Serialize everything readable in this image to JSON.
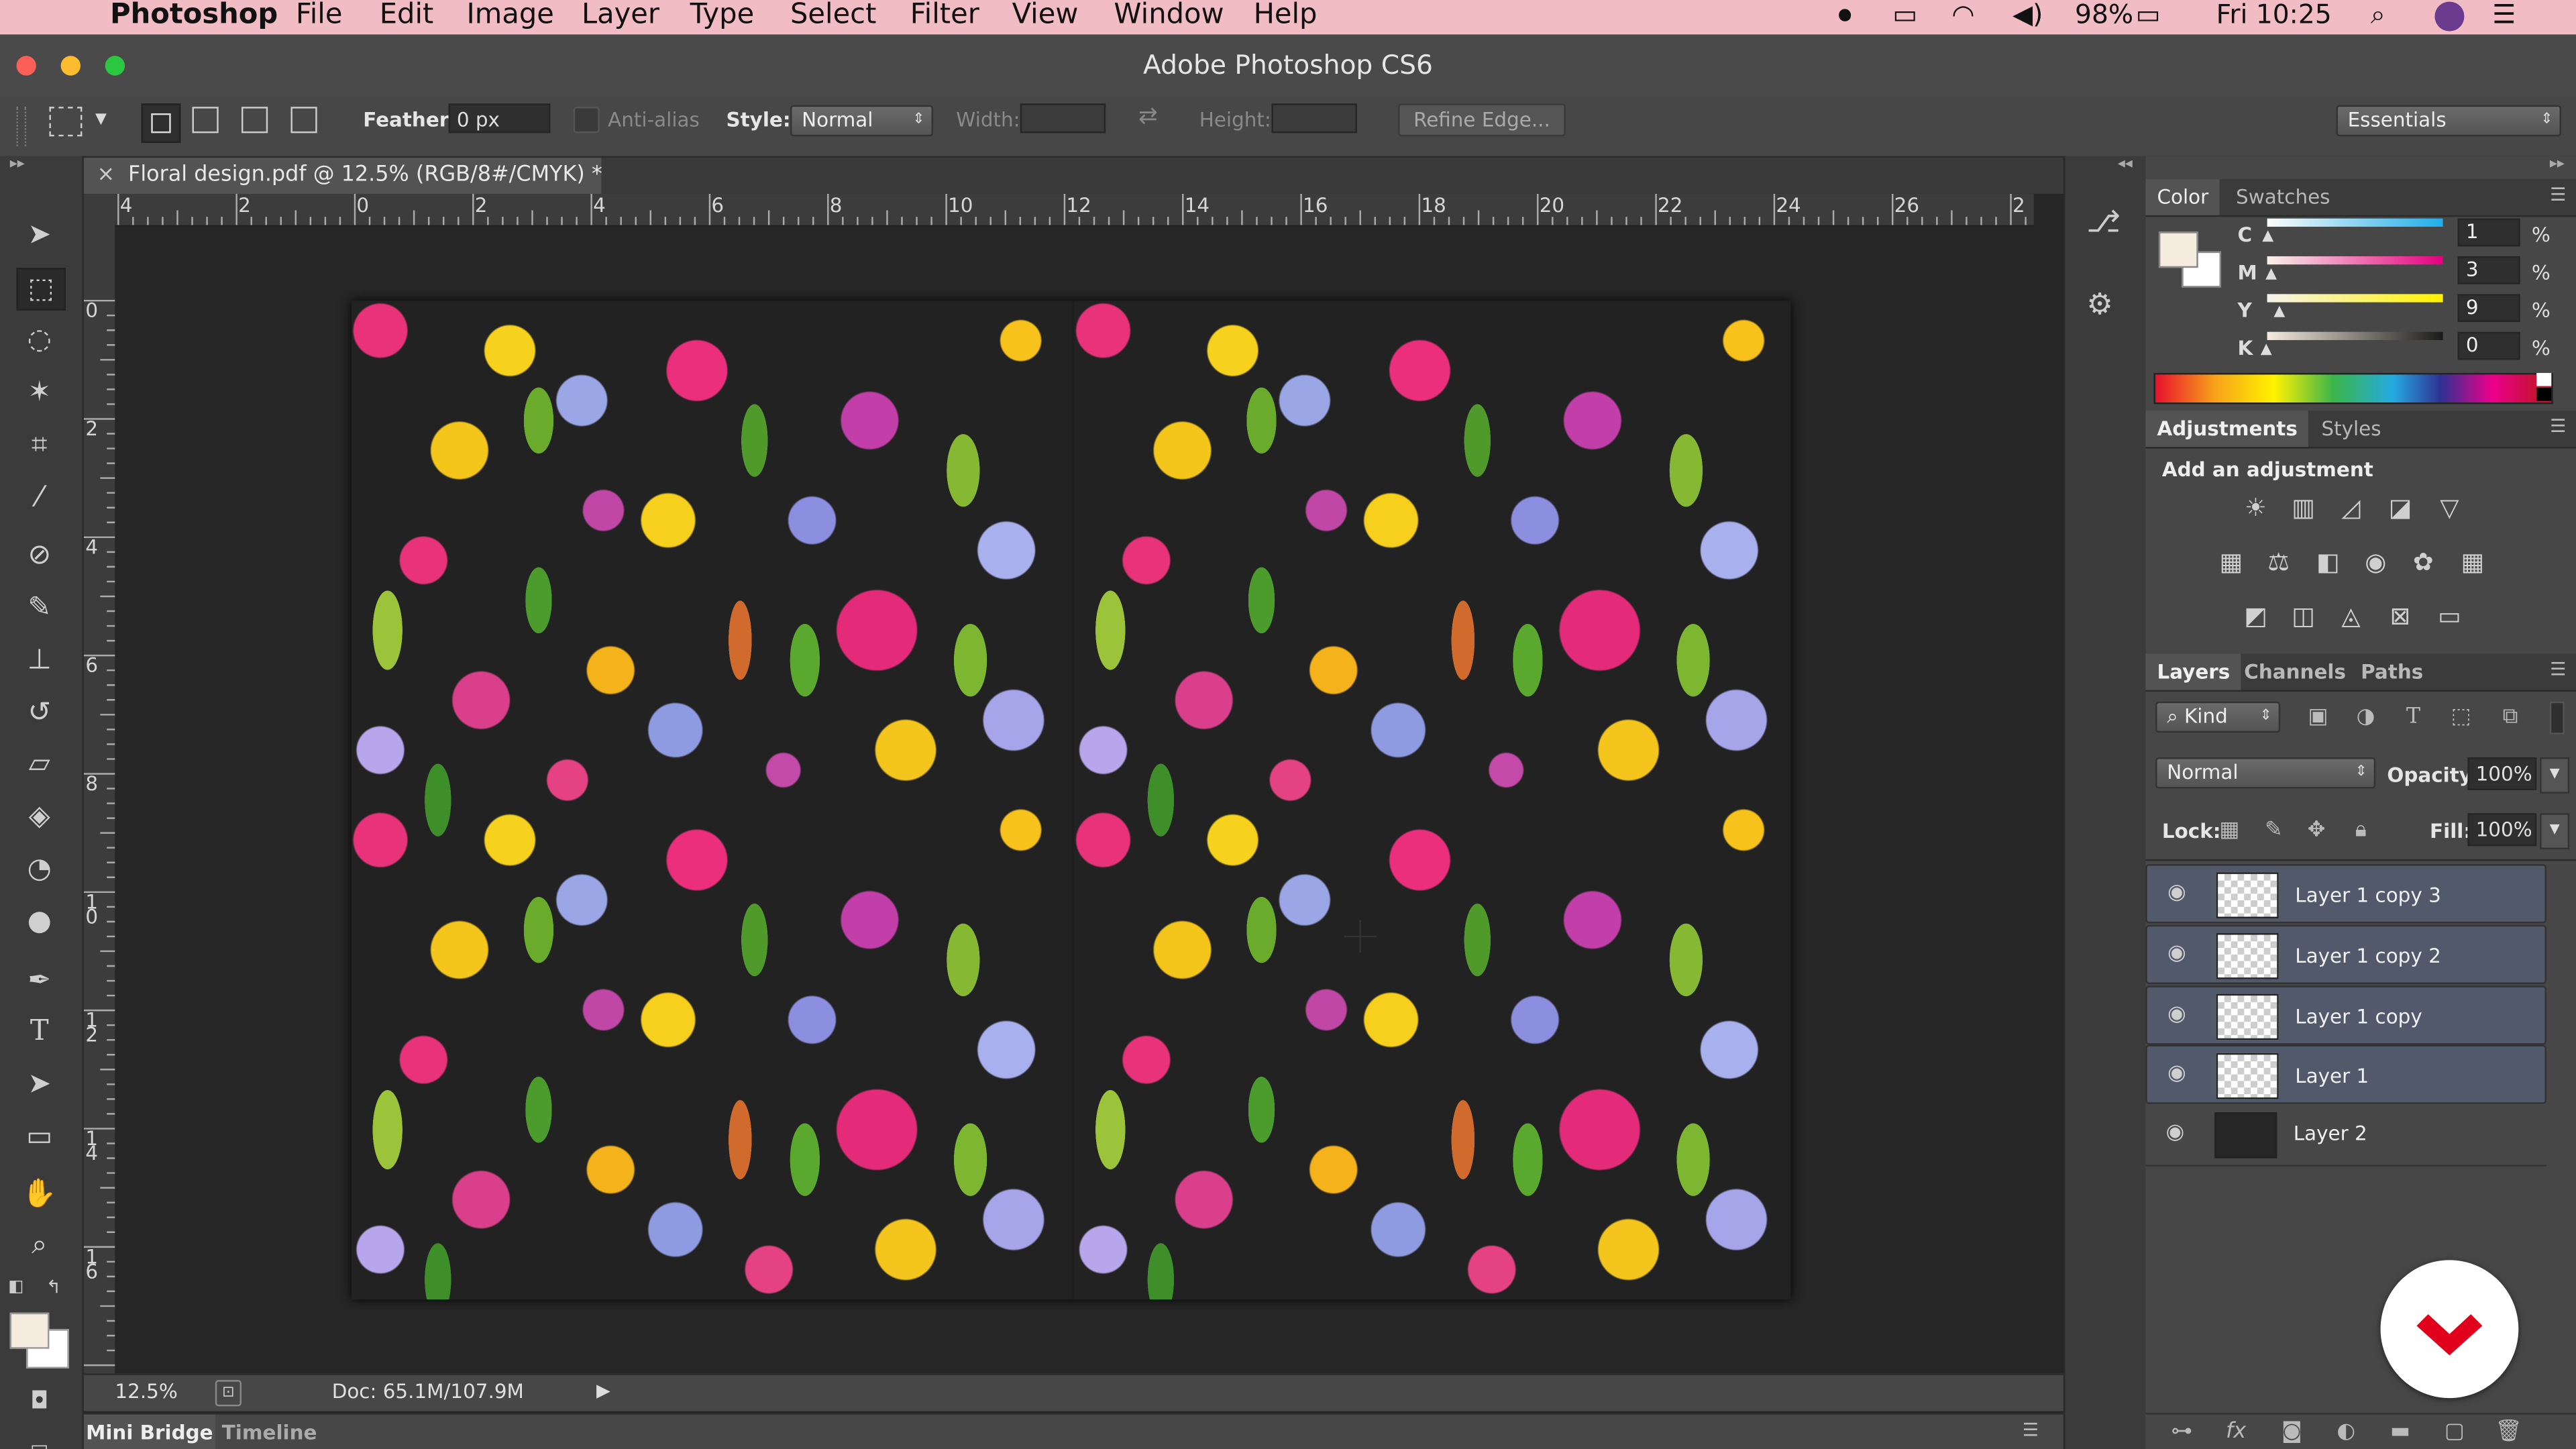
{
  "menubar": {
    "app": "Photoshop",
    "items": [
      "File",
      "Edit",
      "Image",
      "Layer",
      "Type",
      "Select",
      "Filter",
      "View",
      "Window",
      "Help"
    ],
    "battery": "98%",
    "clock": "Fri 10:25"
  },
  "window": {
    "title": "Adobe Photoshop CS6"
  },
  "options": {
    "feather_label": "Feather:",
    "feather_value": "0 px",
    "antialias_label": "Anti-alias",
    "style_label": "Style:",
    "style_value": "Normal",
    "width_label": "Width:",
    "height_label": "Height:",
    "refine_edge": "Refine Edge...",
    "workspace": "Essentials"
  },
  "document": {
    "tab_title": "Floral design.pdf @ 12.5% (RGB/8#/CMYK) *",
    "close_glyph": "×"
  },
  "rulers": {
    "horizontal": [
      "4",
      "2",
      "0",
      "2",
      "4",
      "6",
      "8",
      "10",
      "12",
      "14",
      "16",
      "18",
      "20",
      "22",
      "24",
      "26",
      "2"
    ],
    "vertical": [
      "0",
      "2",
      "4",
      "6",
      "8",
      "1\n0",
      "1\n2",
      "1\n4",
      "1\n6"
    ]
  },
  "statusbar": {
    "zoom": "12.5%",
    "doc": "Doc: 65.1M/107.9M"
  },
  "bottom_tabs": [
    "Mini Bridge",
    "Timeline"
  ],
  "color_panel": {
    "tabs": [
      "Color",
      "Swatches"
    ],
    "fg_color": "#f5ecdf",
    "channels": [
      {
        "label": "C",
        "value": "1",
        "unit": "%"
      },
      {
        "label": "M",
        "value": "3",
        "unit": "%"
      },
      {
        "label": "Y",
        "value": "9",
        "unit": "%"
      },
      {
        "label": "K",
        "value": "0",
        "unit": "%"
      }
    ]
  },
  "adjustments_panel": {
    "tabs": [
      "Adjustments",
      "Styles"
    ],
    "heading": "Add an adjustment"
  },
  "layers_panel": {
    "tabs": [
      "Layers",
      "Channels",
      "Paths"
    ],
    "filter_kind": "Kind",
    "blend_mode": "Normal",
    "opacity_label": "Opacity:",
    "opacity_value": "100%",
    "lock_label": "Lock:",
    "fill_label": "Fill:",
    "fill_value": "100%",
    "layers": [
      {
        "name": "Layer 1 copy 3",
        "selected": true
      },
      {
        "name": "Layer 1 copy 2",
        "selected": true
      },
      {
        "name": "Layer 1 copy",
        "selected": true
      },
      {
        "name": "Layer 1",
        "selected": true
      },
      {
        "name": "Layer 2",
        "selected": false
      }
    ]
  },
  "colors": {
    "accent_red": "#e0001b",
    "menubar_bg": "#f2bcc4",
    "selected_layer": "#52596a"
  }
}
